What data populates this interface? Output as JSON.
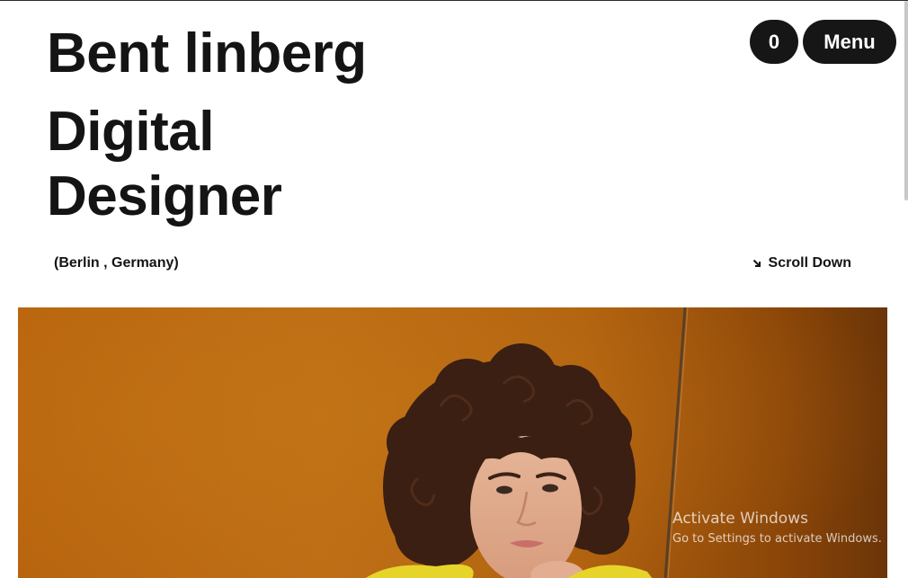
{
  "header": {
    "name": "Bent linberg",
    "role_line1": "Digital",
    "role_line2": "Designer"
  },
  "nav": {
    "cart_count": "0",
    "menu_label": "Menu"
  },
  "info": {
    "location": "(Berlin , Germany)",
    "scroll_label": "Scroll Down"
  },
  "hero": {
    "image_subject": "portrait of young man with curly hair on orange background",
    "background_color": "#b8640f"
  },
  "watermark": {
    "title": "Activate Windows",
    "subtitle": "Go to Settings to activate Windows."
  },
  "colors": {
    "text": "#141414",
    "pill_bg": "#161616",
    "pill_text": "#ffffff"
  },
  "icons": {
    "scroll": "arrow-down-right-icon"
  }
}
